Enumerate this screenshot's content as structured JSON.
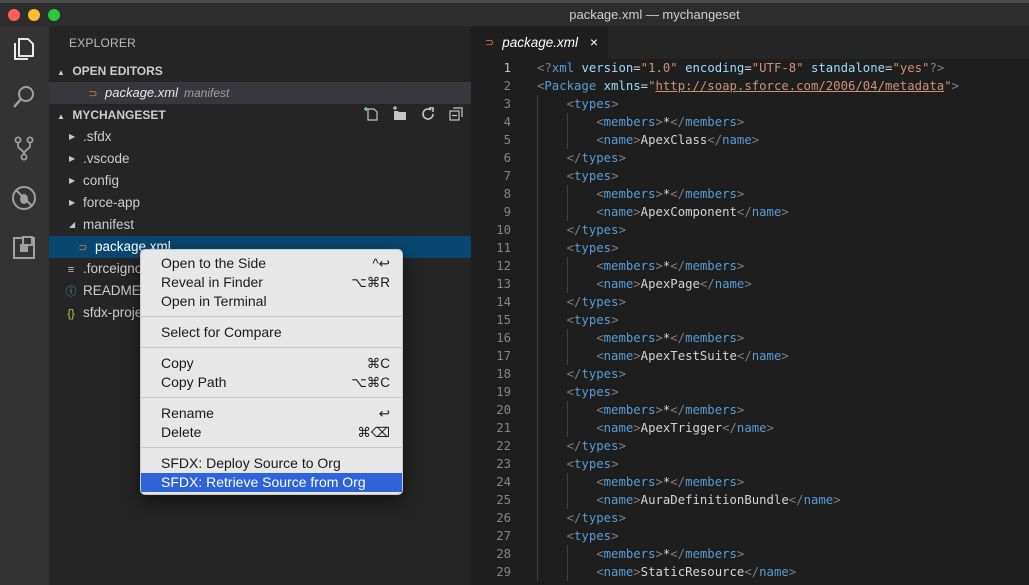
{
  "window": {
    "title": "package.xml — mychangeset"
  },
  "activity_bar": {
    "icons": [
      "explorer-icon",
      "search-icon",
      "source-control-icon",
      "debug-icon",
      "extensions-icon"
    ]
  },
  "sidebar": {
    "header": "EXPLORER",
    "open_editors": {
      "label": "OPEN EDITORS",
      "items": [
        {
          "name": "package.xml",
          "description": "manifest"
        }
      ]
    },
    "project": {
      "label": "MYCHANGESET",
      "actions": [
        "new-file-icon",
        "new-folder-icon",
        "refresh-icon",
        "collapse-all-icon"
      ],
      "tree": [
        {
          "label": ".sfdx",
          "kind": "folder",
          "expanded": false
        },
        {
          "label": ".vscode",
          "kind": "folder",
          "expanded": false
        },
        {
          "label": "config",
          "kind": "folder",
          "expanded": false
        },
        {
          "label": "force-app",
          "kind": "folder",
          "expanded": false
        },
        {
          "label": "manifest",
          "kind": "folder",
          "expanded": true
        },
        {
          "label": "package.xml",
          "kind": "xml-file",
          "selected": true
        },
        {
          "label": ".forceignore",
          "kind": "text-file"
        },
        {
          "label": "README.md",
          "kind": "info-file"
        },
        {
          "label": "sfdx-project.json",
          "kind": "json-file"
        }
      ]
    }
  },
  "editor": {
    "tab": {
      "label": "package.xml",
      "close": "×"
    },
    "current_line": 1,
    "lines": [
      "<?xml version=\"1.0\" encoding=\"UTF-8\" standalone=\"yes\"?>",
      "<Package xmlns=\"http://soap.sforce.com/2006/04/metadata\">",
      "    <types>",
      "        <members>*</members>",
      "        <name>ApexClass</name>",
      "    </types>",
      "    <types>",
      "        <members>*</members>",
      "        <name>ApexComponent</name>",
      "    </types>",
      "    <types>",
      "        <members>*</members>",
      "        <name>ApexPage</name>",
      "    </types>",
      "    <types>",
      "        <members>*</members>",
      "        <name>ApexTestSuite</name>",
      "    </types>",
      "    <types>",
      "        <members>*</members>",
      "        <name>ApexTrigger</name>",
      "    </types>",
      "    <types>",
      "        <members>*</members>",
      "        <name>AuraDefinitionBundle</name>",
      "    </types>",
      "    <types>",
      "        <members>*</members>",
      "        <name>StaticResource</name>"
    ]
  },
  "context_menu": {
    "groups": [
      [
        {
          "label": "Open to the Side",
          "shortcut": "^↩"
        },
        {
          "label": "Reveal in Finder",
          "shortcut": "⌥⌘R"
        },
        {
          "label": "Open in Terminal",
          "shortcut": ""
        }
      ],
      [
        {
          "label": "Select for Compare",
          "shortcut": ""
        }
      ],
      [
        {
          "label": "Copy",
          "shortcut": "⌘C"
        },
        {
          "label": "Copy Path",
          "shortcut": "⌥⌘C"
        }
      ],
      [
        {
          "label": "Rename",
          "shortcut": "↩"
        },
        {
          "label": "Delete",
          "shortcut": "⌘⌫"
        }
      ],
      [
        {
          "label": "SFDX: Deploy Source to Org",
          "shortcut": ""
        },
        {
          "label": "SFDX: Retrieve Source from Org",
          "shortcut": "",
          "highlighted": true
        }
      ]
    ]
  },
  "colors": {
    "accent_highlight": "#2e63d9",
    "selection": "#094771",
    "xml_icon": "#e37933"
  }
}
